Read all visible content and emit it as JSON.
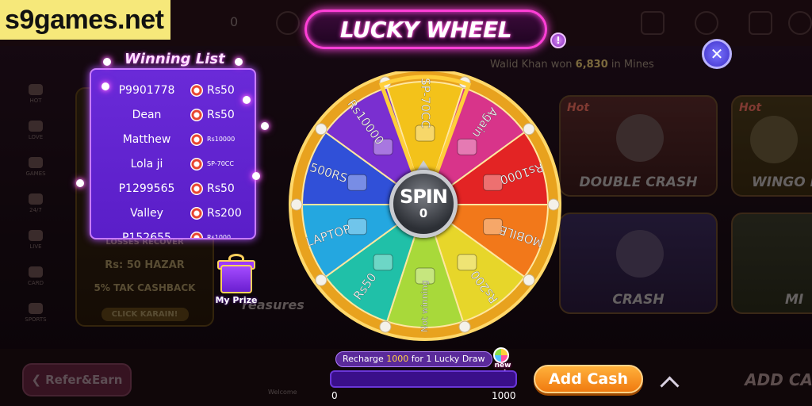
{
  "watermark": "s9games.net",
  "modal": {
    "title": "LUCKY WHEEL",
    "info_icon": "info-icon",
    "close_icon": "close-icon"
  },
  "winning_list": {
    "title": "Winning List",
    "chip_icon": "casino-chip-icon",
    "rows": [
      {
        "name": "P9901778",
        "prize": "Rs50"
      },
      {
        "name": "Dean",
        "prize": "Rs50"
      },
      {
        "name": "Matthew",
        "prize": "Rs10000"
      },
      {
        "name": "Lola ji",
        "prize": "SP-70CC"
      },
      {
        "name": "P1299565",
        "prize": "Rs50"
      },
      {
        "name": "Valley",
        "prize": "Rs200"
      },
      {
        "name": "P152655",
        "prize": "Rs1000"
      }
    ]
  },
  "my_prize": {
    "label": "My Prize",
    "icon": "gift-icon"
  },
  "wheel": {
    "segments": [
      {
        "label": "SP-70CC",
        "color": "#f3c21a",
        "icon": "motorbike-icon"
      },
      {
        "label": "Again",
        "color": "#d8348a",
        "icon": "ticket-icon"
      },
      {
        "label": "Rs1000",
        "color": "#e32424",
        "icon": "cash-stack-icon"
      },
      {
        "label": "MOBILE",
        "color": "#f2781a",
        "icon": "phone-icon"
      },
      {
        "label": "Rs200",
        "color": "#e7d62a",
        "icon": "cash-stack-icon"
      },
      {
        "label": "Not winning",
        "color": "#a8d93a",
        "icon": "smile-icon"
      },
      {
        "label": "Rs50",
        "color": "#20c0a8",
        "icon": "cash-stack-icon"
      },
      {
        "label": "LAPTOP",
        "color": "#24a7e0",
        "icon": "laptop-icon"
      },
      {
        "label": "500RS",
        "color": "#3050d8",
        "icon": "cash-stack-icon"
      },
      {
        "label": "Rs10000",
        "color": "#7a2fd0",
        "icon": "treasure-chest-icon"
      }
    ],
    "spin_label": "SPIN",
    "spin_count": "0"
  },
  "recharge": {
    "text_before": "Recharge ",
    "amount": "1000",
    "text_after": " for 1 Lucky Draw",
    "new_spin": "new spin",
    "progress": 0,
    "min": "0",
    "max": "1000"
  },
  "add_cash_button": "Add Cash",
  "background": {
    "ticker_prefix": "Walid Khan won ",
    "ticker_amount": "6,830",
    "ticker_suffix": " in Mines",
    "top_balance": "0",
    "refer_button": "Refer&Earn",
    "add_cash_bg": "ADD CA",
    "nav": [
      "HOT",
      "LOVE",
      "GAMES",
      "24/7",
      "LIVE",
      "CARD",
      "SPORTS",
      "LIVE"
    ],
    "cards": [
      {
        "hot": "Hot",
        "caption": "DOUBLE CRASH"
      },
      {
        "hot": "Hot",
        "caption": "WINGO L"
      },
      {
        "hot": "",
        "caption": "CRASH"
      },
      {
        "hot": "",
        "caption": "MI"
      },
      {
        "hot": "",
        "caption": "reasures"
      }
    ],
    "promo": {
      "line1": "LOSSES RECOVER",
      "line2": "Rs: 50 HAZAR",
      "line3": "5% TAK CASHBACK",
      "button": "CLICK KARAIN!"
    },
    "bottom_tab": "Welcome"
  }
}
